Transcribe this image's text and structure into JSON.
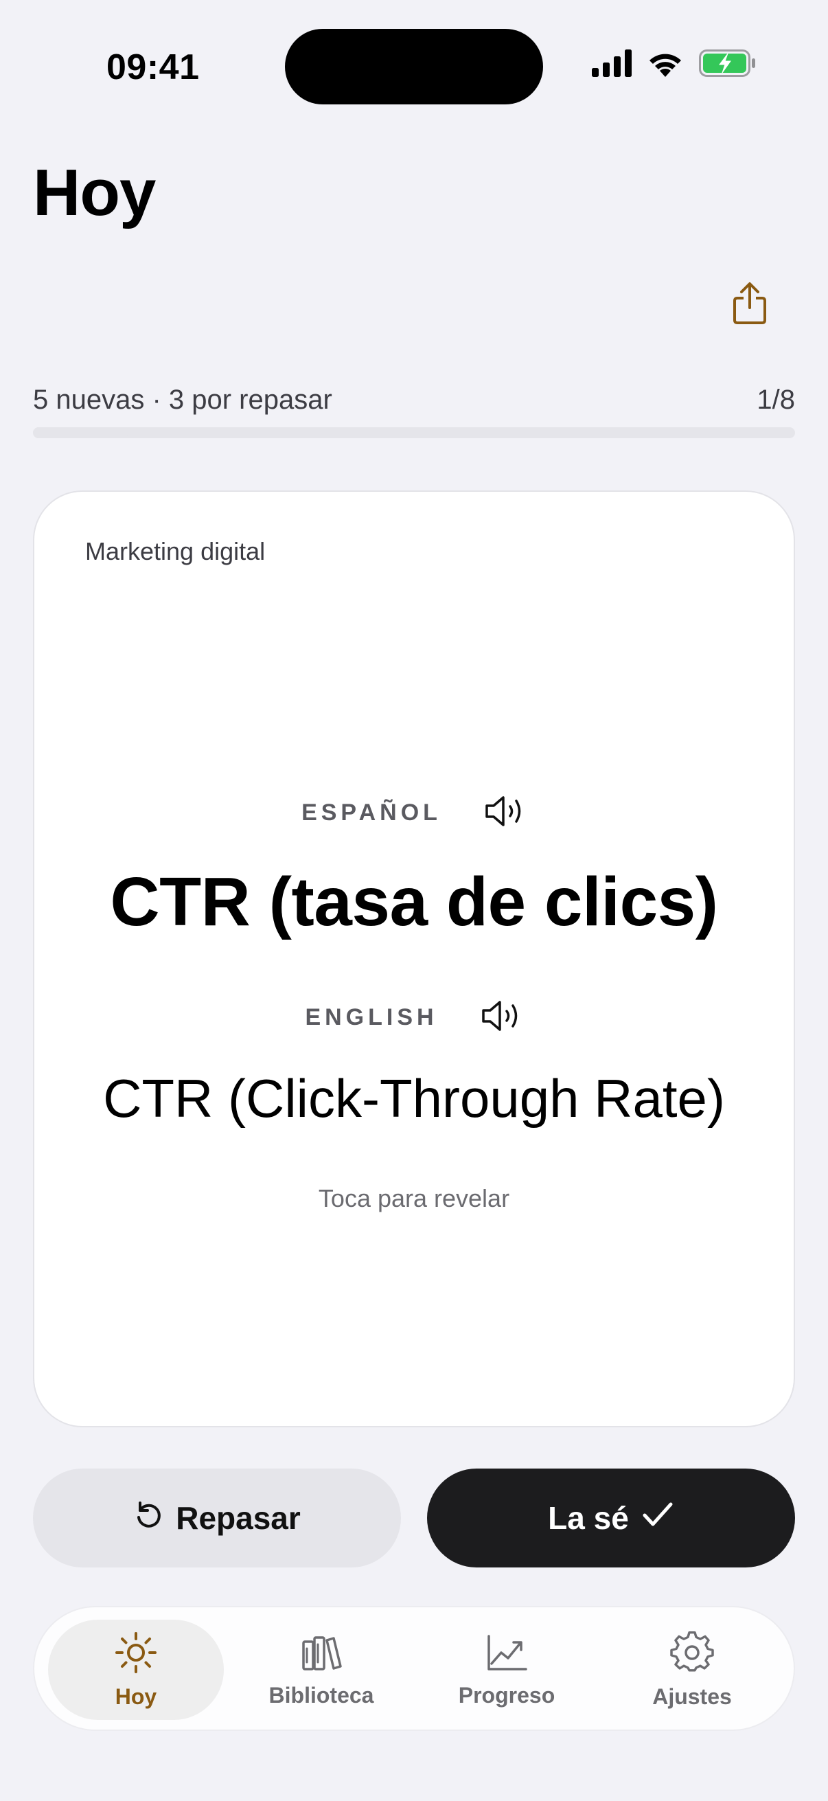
{
  "status_bar": {
    "time": "09:41",
    "icons": [
      "cellular-signal-icon",
      "wifi-icon",
      "battery-charging-icon"
    ]
  },
  "header": {
    "title": "Hoy",
    "share_icon": "share-icon"
  },
  "progress": {
    "summary": "5 nuevas · 3 por repasar",
    "count": "1/8",
    "fraction": 0.125
  },
  "card": {
    "deck": "Marketing digital",
    "source_language": "ESPAÑOL",
    "source_term": "CTR (tasa de clics)",
    "target_language": "ENGLISH",
    "target_term": "CTR (Click-Through Rate)",
    "hint": "Toca para revelar"
  },
  "actions": {
    "review_label": "Repasar",
    "know_label": "La sé"
  },
  "tabs": [
    {
      "label": "Hoy",
      "icon": "sun-icon",
      "active": true
    },
    {
      "label": "Biblioteca",
      "icon": "books-icon",
      "active": false
    },
    {
      "label": "Progreso",
      "icon": "chart-line-icon",
      "active": false
    },
    {
      "label": "Ajustes",
      "icon": "gear-icon",
      "active": false
    }
  ],
  "colors": {
    "background": "#F2F2F7",
    "accent": "#8A5A12",
    "primary_button": "#1C1C1E",
    "battery_green": "#34C759"
  }
}
